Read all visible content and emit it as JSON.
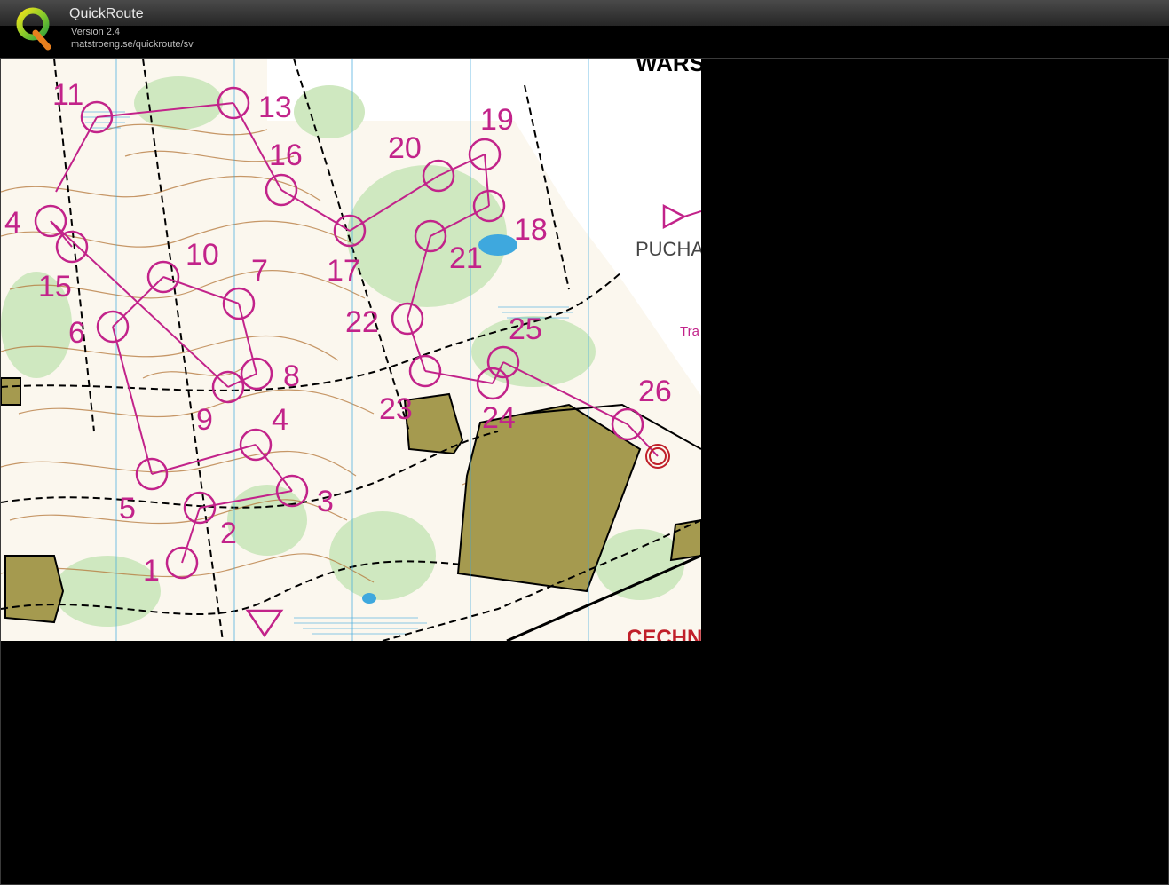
{
  "app": {
    "title": "QuickRoute",
    "version": "Version 2.4",
    "url": "matstroeng.se/quickroute/sv"
  },
  "logo": {
    "letter": "Q"
  },
  "map": {
    "labels": {
      "top_right": "WARS",
      "place": "PUCHA",
      "small": "Tra",
      "bottom_right": "CECHN"
    },
    "controls": [
      {
        "n": "1"
      },
      {
        "n": "2"
      },
      {
        "n": "3"
      },
      {
        "n": "4"
      },
      {
        "n": "4"
      },
      {
        "n": "5"
      },
      {
        "n": "6"
      },
      {
        "n": "7"
      },
      {
        "n": "8"
      },
      {
        "n": "9"
      },
      {
        "n": "10"
      },
      {
        "n": "11"
      },
      {
        "n": "13"
      },
      {
        "n": "15"
      },
      {
        "n": "16"
      },
      {
        "n": "17"
      },
      {
        "n": "18"
      },
      {
        "n": "19"
      },
      {
        "n": "20"
      },
      {
        "n": "21"
      },
      {
        "n": "22"
      },
      {
        "n": "23"
      },
      {
        "n": "24"
      },
      {
        "n": "25"
      },
      {
        "n": "26"
      }
    ]
  },
  "colors": {
    "course": "#c2238a",
    "open_land": "#fbf7ee",
    "forest": "#cfe8c0",
    "settlement": "#a59a4f",
    "contour": "#b5773a",
    "water": "#3ea8de"
  }
}
